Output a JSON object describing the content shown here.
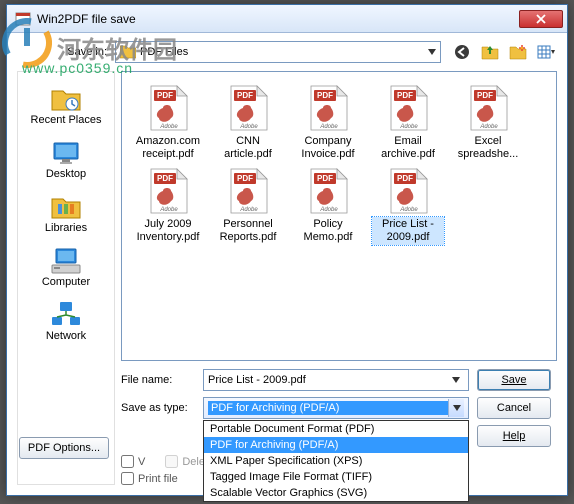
{
  "window": {
    "title": "Win2PDF file save"
  },
  "watermark": {
    "main": "河东软件园",
    "sub": "www.pc0359.cn"
  },
  "save_in": {
    "label": "Save in:",
    "value": "PDF Files"
  },
  "toolbar": {
    "back": "back",
    "up": "up-one-level",
    "newfolder": "new-folder",
    "views": "view-menu"
  },
  "places": [
    {
      "icon": "recent",
      "label": "Recent Places"
    },
    {
      "icon": "desktop",
      "label": "Desktop"
    },
    {
      "icon": "libraries",
      "label": "Libraries"
    },
    {
      "icon": "computer",
      "label": "Computer"
    },
    {
      "icon": "network",
      "label": "Network"
    }
  ],
  "files": [
    {
      "name": "Amazon.com receipt.pdf",
      "selected": false
    },
    {
      "name": "CNN article.pdf",
      "selected": false
    },
    {
      "name": "Company Invoice.pdf",
      "selected": false
    },
    {
      "name": "Email archive.pdf",
      "selected": false
    },
    {
      "name": "Excel spreadshe...",
      "selected": false
    },
    {
      "name": "July 2009 Inventory.pdf",
      "selected": false
    },
    {
      "name": "Personnel Reports.pdf",
      "selected": false
    },
    {
      "name": "Policy Memo.pdf",
      "selected": false
    },
    {
      "name": "Price List - 2009.pdf",
      "selected": true
    }
  ],
  "filename": {
    "label": "File name:",
    "value": "Price List - 2009.pdf"
  },
  "savetype": {
    "label": "Save as type:",
    "selected": "PDF for Archiving (PDF/A)",
    "options": [
      "Portable Document Format (PDF)",
      "PDF for Archiving (PDF/A)",
      "XML Paper Specification (XPS)",
      "Tagged Image File Format (TIFF)",
      "Scalable Vector Graphics (SVG)"
    ],
    "selected_index": 1
  },
  "buttons": {
    "save": "Save",
    "cancel": "Cancel",
    "help": "Help",
    "pdf_options": "PDF Options..."
  },
  "checks": {
    "view_file": "V",
    "print_file": "Print file",
    "delete_after": "Delete after sending"
  }
}
